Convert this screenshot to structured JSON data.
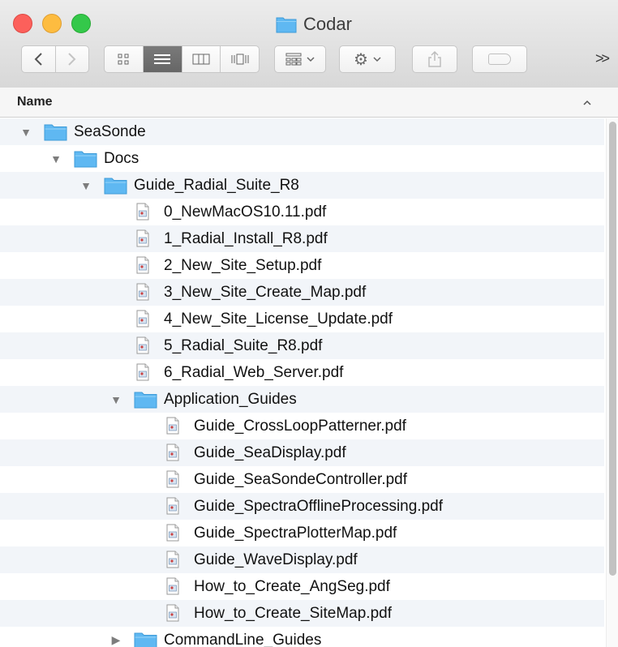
{
  "window": {
    "title": "Codar"
  },
  "toolbar": {
    "back_icon": "back-chevron-icon",
    "forward_icon": "forward-chevron-icon",
    "view_modes": [
      "icon-view",
      "list-view",
      "column-view",
      "cover-flow-view"
    ],
    "active_view": "list-view",
    "overflow_label": ">>"
  },
  "columns": {
    "name": "Name",
    "sort_indicator": "^"
  },
  "colors": {
    "folder": "#5fb8f2",
    "stripe": "#f2f5f9",
    "active_segment": "#6e6e6e"
  },
  "rows": [
    {
      "label": "SeaSonde",
      "type": "folder",
      "level": 0,
      "disclosure": "expanded"
    },
    {
      "label": "Docs",
      "type": "folder",
      "level": 1,
      "disclosure": "expanded"
    },
    {
      "label": "Guide_Radial_Suite_R8",
      "type": "folder",
      "level": 2,
      "disclosure": "expanded"
    },
    {
      "label": "0_NewMacOS10.11.pdf",
      "type": "pdf",
      "level": 3
    },
    {
      "label": "1_Radial_Install_R8.pdf",
      "type": "pdf",
      "level": 3
    },
    {
      "label": "2_New_Site_Setup.pdf",
      "type": "pdf",
      "level": 3
    },
    {
      "label": "3_New_Site_Create_Map.pdf",
      "type": "pdf",
      "level": 3
    },
    {
      "label": "4_New_Site_License_Update.pdf",
      "type": "pdf",
      "level": 3
    },
    {
      "label": "5_Radial_Suite_R8.pdf",
      "type": "pdf",
      "level": 3
    },
    {
      "label": "6_Radial_Web_Server.pdf",
      "type": "pdf",
      "level": 3
    },
    {
      "label": "Application_Guides",
      "type": "folder",
      "level": 3,
      "disclosure": "expanded"
    },
    {
      "label": "Guide_CrossLoopPatterner.pdf",
      "type": "pdf",
      "level": 4
    },
    {
      "label": "Guide_SeaDisplay.pdf",
      "type": "pdf",
      "level": 4
    },
    {
      "label": "Guide_SeaSondeController.pdf",
      "type": "pdf",
      "level": 4
    },
    {
      "label": "Guide_SpectraOfflineProcessing.pdf",
      "type": "pdf",
      "level": 4
    },
    {
      "label": "Guide_SpectraPlotterMap.pdf",
      "type": "pdf",
      "level": 4
    },
    {
      "label": "Guide_WaveDisplay.pdf",
      "type": "pdf",
      "level": 4
    },
    {
      "label": "How_to_Create_AngSeg.pdf",
      "type": "pdf",
      "level": 4
    },
    {
      "label": "How_to_Create_SiteMap.pdf",
      "type": "pdf",
      "level": 4
    },
    {
      "label": "CommandLine_Guides",
      "type": "folder",
      "level": 3,
      "disclosure": "collapsed"
    }
  ]
}
